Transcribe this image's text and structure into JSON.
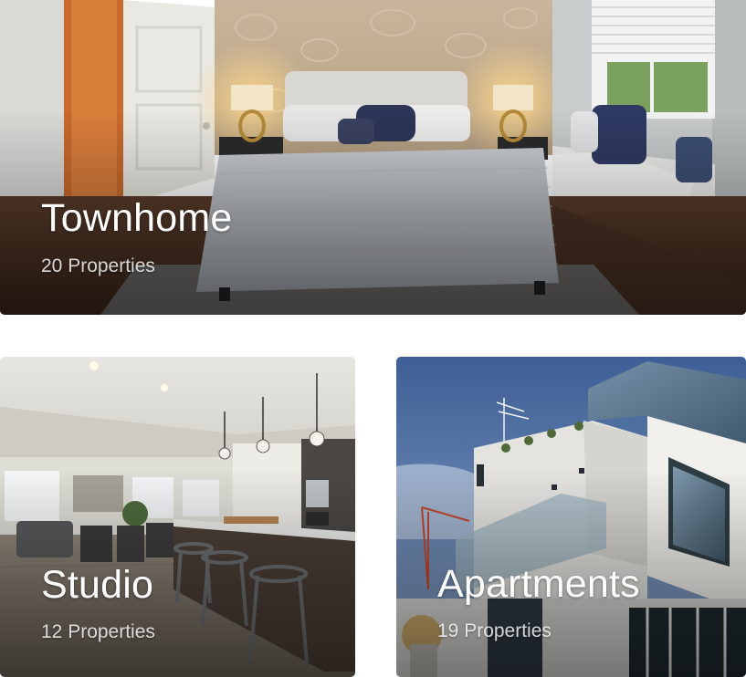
{
  "categories": [
    {
      "title": "Townhome",
      "count_label": "20 Properties",
      "image_subject": "bedroom-photo"
    },
    {
      "title": "Studio",
      "count_label": "12 Properties",
      "image_subject": "kitchen-photo"
    },
    {
      "title": "Apartments",
      "count_label": "19 Properties",
      "image_subject": "building-photo"
    }
  ],
  "colors": {
    "text": "#ffffff",
    "page_background": "#ffffff"
  }
}
